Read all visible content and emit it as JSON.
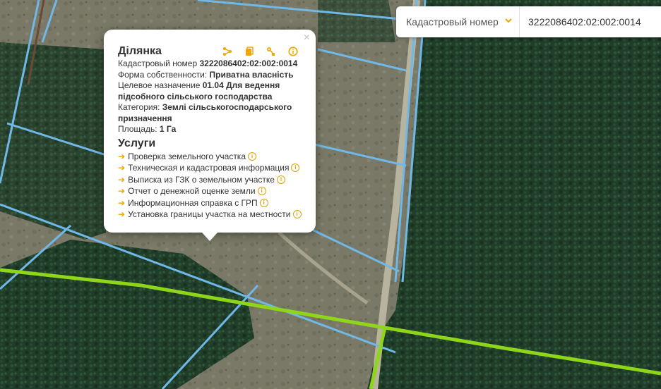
{
  "search": {
    "type_label": "Кадастровый номер",
    "value": "3222086402:02:002:0014"
  },
  "popup": {
    "title": "Ділянка",
    "cadastral_label": "Кадастровый номер",
    "cadastral_value": "3222086402:02:002:0014",
    "ownership_label": "Форма собственности:",
    "ownership_value": "Приватна власність",
    "purpose_label": "Целевое назначение",
    "purpose_value_1": "01.04 Для ведення",
    "purpose_value_2": "підсобного сільського господарства",
    "category_label": "Категория:",
    "category_value_1": "Землі сільськогосподарського",
    "category_value_2": "призначення",
    "area_label": "Площадь:",
    "area_value": "1 Га",
    "services_title": "Услуги",
    "services": [
      "Проверка земельного участка",
      "Техническая и кадастровая информация",
      "Выписка из ГЗК о земельном участке",
      "Отчет о денежной оценке земли",
      "Информационная справка с ГРП",
      "Установка границы участка на местности"
    ],
    "close_glyph": "×",
    "arrow_glyph": "➔",
    "info_glyph": "i"
  },
  "icons": {
    "share": "share-icon",
    "copy": "copy-icon",
    "location": "location-icon",
    "info": "info-icon",
    "close": "close-icon",
    "dropdown": "chevron-down-icon"
  },
  "colors": {
    "accent": "#f0a500",
    "parcel_border": "#6fb8e8",
    "boundary_line": "#8fd61a",
    "forest": "#1e3b27",
    "field": "#7d7c68"
  }
}
